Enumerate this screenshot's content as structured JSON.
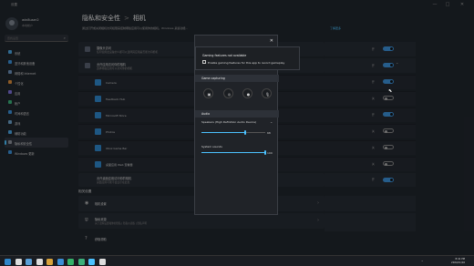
{
  "window": {
    "title": "设置",
    "controls": [
      "—",
      "□",
      "✕"
    ]
  },
  "user": {
    "name": "win8user2",
    "account": "本地帐户"
  },
  "search": {
    "placeholder": "查找设置",
    "icon": "search-icon"
  },
  "nav": [
    {
      "label": "系统",
      "color": "#4aa3df"
    },
    {
      "label": "蓝牙和其他设备",
      "color": "#3b8fd6"
    },
    {
      "label": "网络和 Internet",
      "color": "#6c8fb8"
    },
    {
      "label": "个性化",
      "color": "#d98c3b"
    },
    {
      "label": "应用",
      "color": "#7c6fd6"
    },
    {
      "label": "帐户",
      "color": "#3bb07a"
    },
    {
      "label": "时间和语言",
      "color": "#3b8fd6"
    },
    {
      "label": "游戏",
      "color": "#6aa0c8"
    },
    {
      "label": "辅助功能",
      "color": "#4aa3df"
    },
    {
      "label": "隐私和安全性",
      "color": "#8a8f99",
      "active": true
    },
    {
      "label": "Windows 更新",
      "color": "#3b8fd6"
    }
  ],
  "main": {
    "breadcrumb_parent": "隐私和安全性",
    "breadcrumb_sep": ">",
    "breadcrumb_current": "相机",
    "description": "通过打开或关闭相机访问权限来控制哪些应用可以使用你的相机。Windows 某些功能...",
    "learn_more": "了解更多"
  },
  "cards": {
    "camera_access": {
      "title": "摄像头访问",
      "subtitle": "任何使用此设备的人都可以选择其应用是否能访问相机"
    },
    "app_access": {
      "title": "允许应用访问你的相机",
      "subtitle": "选择哪些应用可以访问你的相机"
    },
    "desktop_apps": {
      "title": "允许桌面应用访问你的相机",
      "subtitle": "桌面应用可能不会显示在此处"
    }
  },
  "apps": [
    {
      "label": "Camera",
      "state": "on"
    },
    {
      "label": "Feedback Hub",
      "state": "off"
    },
    {
      "label": "Microsoft Store",
      "state": "on"
    },
    {
      "label": "Photos",
      "state": "off"
    },
    {
      "label": "Xbox Game Bar",
      "state": "off"
    },
    {
      "label": "桌面应用 Web 查看器",
      "state": "off"
    }
  ],
  "toggles": {
    "on_label": "开",
    "off_label": "关"
  },
  "related": {
    "title": "相关设置",
    "items": [
      {
        "label": "相机设置",
        "icon": "camera-icon"
      },
      {
        "label": "隐私资源",
        "sub": "关于这些设置和你的隐私 | 隐私仪表板 | 隐私声明",
        "icon": "shield-icon"
      },
      {
        "label": "获取帮助",
        "icon": "help-icon"
      }
    ]
  },
  "gamebar": {
    "close": "✕",
    "warning": "Gaming features not available",
    "checkbox_label": "Enable gaming features for this app to record gameplay",
    "capture_title": "Game capturing",
    "capture_buttons": [
      "▣",
      "◎",
      "●",
      "🎙"
    ],
    "audio_title": "Audio",
    "device": "Speakers (High Definition Audio Device)",
    "device_volume": 68,
    "system_label": "System sounds",
    "system_volume": 100
  },
  "taskbar": {
    "icons": [
      "#2f86c9",
      "#ddd",
      "#5aa0d8",
      "#ddd",
      "#d9a33b",
      "#3b8fd6",
      "#35b36a",
      "#3bb07a",
      "#4cc2ff",
      "#ddd"
    ],
    "tray": "^",
    "time": "8:41 PM",
    "date": "2024/11/16"
  }
}
